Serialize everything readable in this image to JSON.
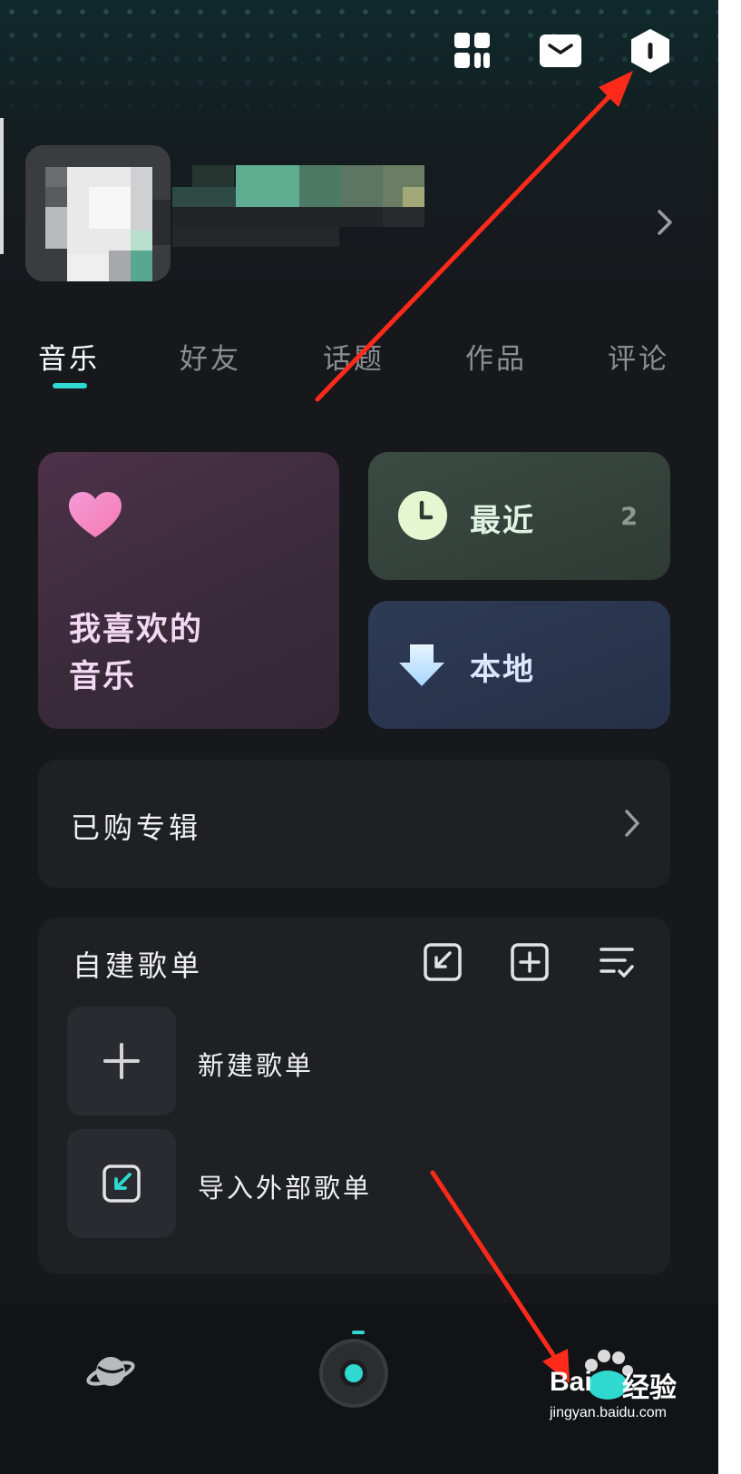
{
  "tabs": [
    {
      "label": "音乐"
    },
    {
      "label": "好友"
    },
    {
      "label": "话题"
    },
    {
      "label": "作品"
    },
    {
      "label": "评论"
    }
  ],
  "quick_access": {
    "favorites_line1": "我喜欢的",
    "favorites_line2": "音乐",
    "recent_label": "最近",
    "recent_count": "2",
    "local_label": "本地"
  },
  "purchased": {
    "label": "已购专辑"
  },
  "playlists": {
    "title": "自建歌单",
    "items": [
      {
        "label": "新建歌单"
      },
      {
        "label": "导入外部歌单"
      }
    ]
  },
  "icons": {
    "top_bar": [
      "apps-grid-icon",
      "mail-icon",
      "settings-hexagon-icon"
    ],
    "bottom_nav": [
      "planet-icon",
      "vinyl-player-icon"
    ]
  },
  "watermark": {
    "brand": "Bai",
    "brand_cn": "经验",
    "url": "jingyan.baidu.com"
  },
  "colors": {
    "accent": "#2fd9cf",
    "background": "#17181c",
    "annotation_arrow": "#ff2a1a"
  }
}
